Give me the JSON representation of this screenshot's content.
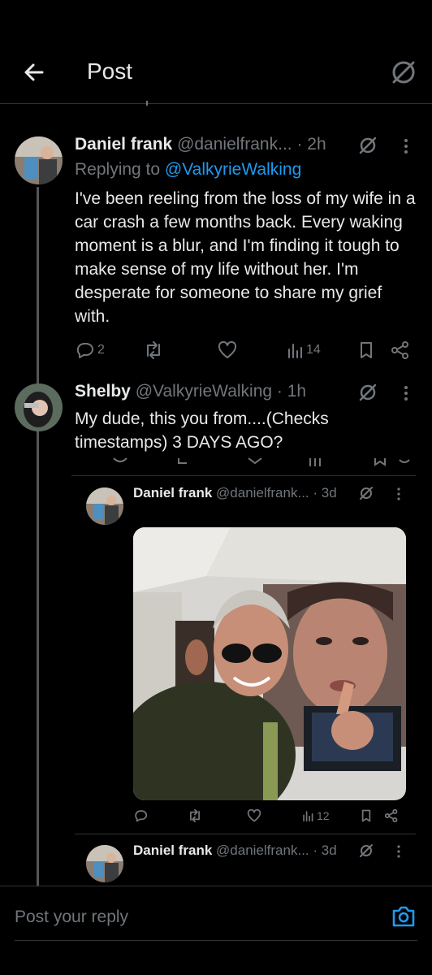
{
  "header": {
    "title": "Post"
  },
  "post1": {
    "name": "Daniel frank",
    "handle": "@danielfrank...",
    "time": "· 2h",
    "replying_prefix": "Replying to ",
    "replying_to": "@ValkyrieWalking",
    "text": "I've been reeling from the loss of my wife in a car crash a few months back. Every waking moment is a blur, and I'm finding it tough to make sense of my life without her. I'm desperate for someone to share my grief with.",
    "replies": "2",
    "views": "14"
  },
  "post2": {
    "name": "Shelby",
    "handle": "@ValkyrieWalking",
    "time": "· 1h",
    "text": "My dude, this you from....(Checks timestamps) 3 DAYS AGO?"
  },
  "quoted1": {
    "name": "Daniel frank",
    "handle": "@danielfrank...",
    "time": "· 3d",
    "views": "12"
  },
  "quoted2": {
    "name": "Daniel frank",
    "handle": "@danielfrank...",
    "time": "· 3d"
  },
  "reply_bar": {
    "placeholder": "Post your reply"
  },
  "icons": {
    "back": "arrow-left-icon",
    "grok": "grok-icon",
    "more": "more-vertical-icon",
    "reply": "reply-icon",
    "repost": "repost-icon",
    "like": "heart-icon",
    "views": "analytics-icon",
    "bookmark": "bookmark-icon",
    "share": "share-icon",
    "camera": "camera-icon"
  },
  "colors": {
    "background": "#000000",
    "text": "#e7e9ea",
    "muted": "#71767b",
    "link": "#1d9bf0"
  }
}
